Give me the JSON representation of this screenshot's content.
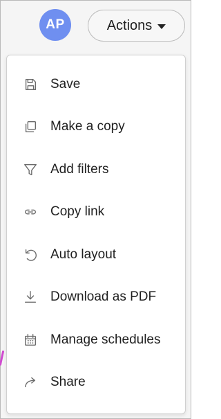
{
  "header": {
    "avatar_initials": "AP",
    "actions_label": "Actions"
  },
  "menu": {
    "items": [
      {
        "label": "Save",
        "icon": "save-icon"
      },
      {
        "label": "Make a copy",
        "icon": "copy-icon"
      },
      {
        "label": "Add filters",
        "icon": "filter-icon"
      },
      {
        "label": "Copy link",
        "icon": "link-icon"
      },
      {
        "label": "Auto layout",
        "icon": "undo-icon"
      },
      {
        "label": "Download as PDF",
        "icon": "download-icon"
      },
      {
        "label": "Manage schedules",
        "icon": "calendar-icon"
      },
      {
        "label": "Share",
        "icon": "share-icon"
      }
    ]
  },
  "colors": {
    "avatar_bg": "#6f8ff0",
    "icon_stroke": "#6b6b6b",
    "edge_accent": "#d04ad0"
  }
}
